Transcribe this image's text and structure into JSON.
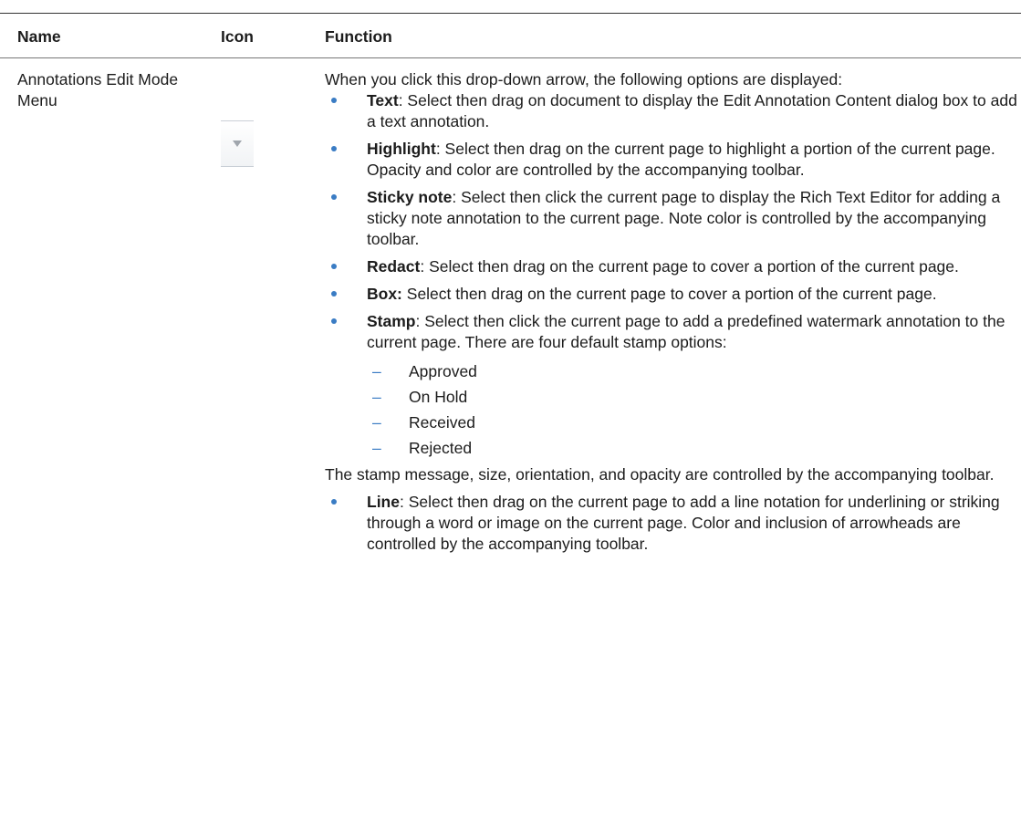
{
  "table": {
    "headers": {
      "name": "Name",
      "icon": "Icon",
      "function": "Function"
    },
    "row": {
      "name": "Annotations Edit Mode Menu",
      "icon": "dropdown-arrow-icon",
      "intro": "When you click this drop-down arrow, the following options are displayed:",
      "options": [
        {
          "term": "Text",
          "sep": ": ",
          "desc": "Select then drag on document to display the Edit Annotation Content dialog box to add a text annotation."
        },
        {
          "term": "Highlight",
          "sep": ": ",
          "desc": "Select then drag on the current page to highlight a portion of the current page. Opacity and color are controlled by the accompanying toolbar."
        },
        {
          "term": "Sticky note",
          "sep": ": ",
          "desc": "Select then click the current page to display the Rich Text Editor for adding a sticky note annotation to the current page. Note color is controlled by the accompanying toolbar."
        },
        {
          "term": "Redact",
          "sep": ": ",
          "desc": "Select then drag on the current page to cover a portion of the current page."
        },
        {
          "term": "Box:",
          "sep": " ",
          "desc": "Select then drag on the current page to cover a portion of the current page."
        },
        {
          "term": "Stamp",
          "sep": ": ",
          "desc": "Select then click the current page to add a predefined watermark annotation to the current page. There are four default stamp options:",
          "stamp_options": [
            "Approved",
            "On Hold",
            "Received",
            "Rejected"
          ],
          "after": "The stamp message, size, orientation, and opacity are controlled by the accompanying toolbar."
        },
        {
          "term": "Line",
          "sep": ": ",
          "desc": "Select then drag on the current page to add a line notation for underlining or striking through a word or image on the current page. Color and inclusion of arrowheads are controlled by the accompanying toolbar."
        }
      ]
    }
  },
  "colors": {
    "bullet": "#3a7cc4",
    "text": "#1c1c1c",
    "rule": "#333333"
  }
}
